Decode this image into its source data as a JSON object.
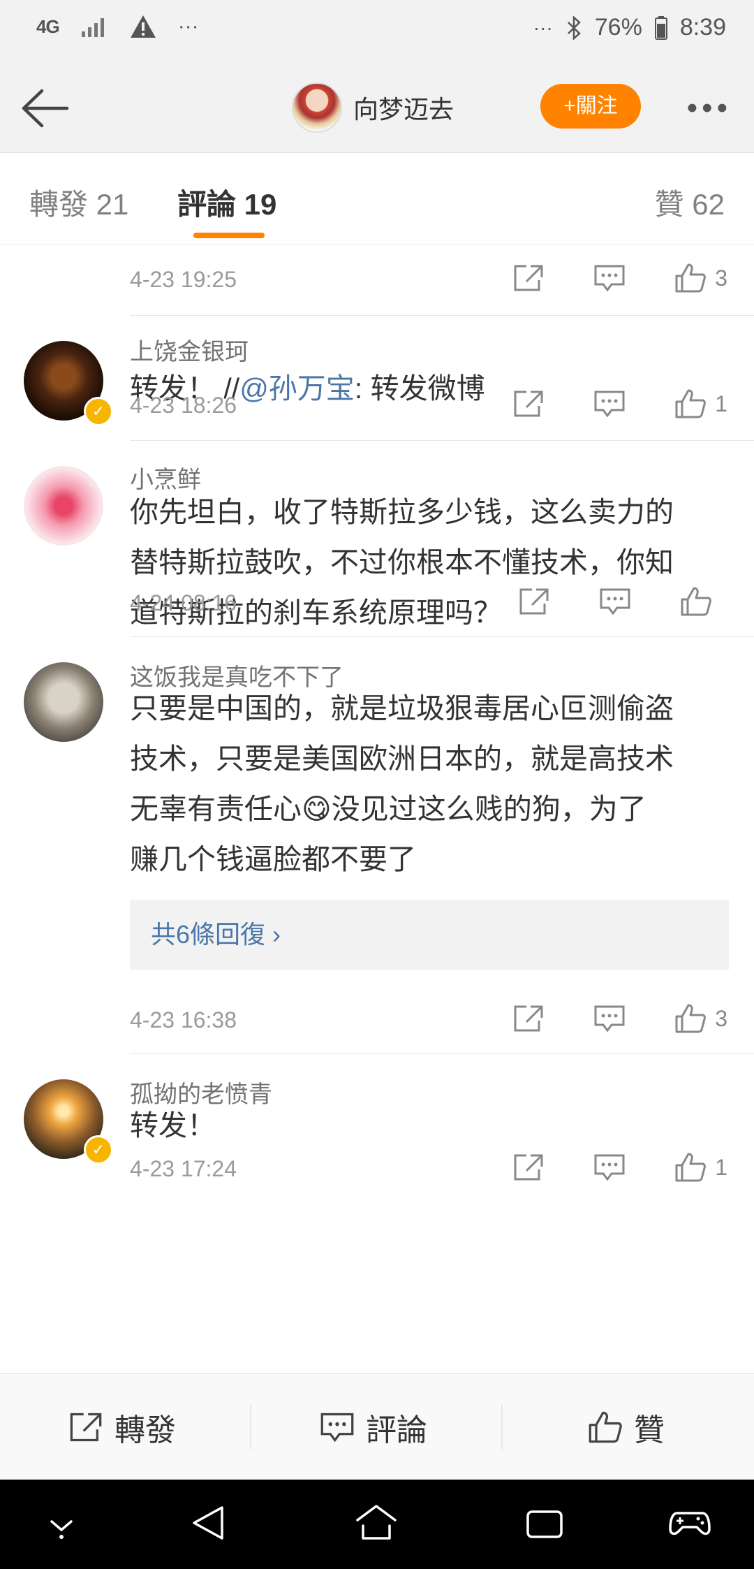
{
  "status_bar": {
    "network": "4G",
    "battery": "76%",
    "time": "8:39"
  },
  "header": {
    "title": "向梦迈去",
    "follow_label": "+關注"
  },
  "tabs": [
    {
      "label": "轉發 21"
    },
    {
      "label": "評論 19"
    },
    {
      "label": "贊 62"
    }
  ],
  "comments": [
    {
      "timestamp": "4-23 19:25",
      "likes": "3"
    },
    {
      "name": "上饶金银珂",
      "text_prefix": "转发！ //",
      "mention": "@孙万宝",
      "text_suffix": ": 转发微博",
      "timestamp": "4-23 18:26",
      "likes": "1"
    },
    {
      "name": "小烹鲜",
      "text_lines": [
        "你先坦白，收了特斯拉多少钱，这么卖力的",
        "替特斯拉鼓吹，不过你根本不懂技术，你知",
        "道特斯拉的刹车系统原理吗？"
      ],
      "timestamp": "4-24 08:16",
      "likes": ""
    },
    {
      "name": "这饭我是真吃不下了",
      "text_lines": [
        "只要是中国的，就是垃圾狠毒居心叵测偷盗",
        "技术，只要是美国欧洲日本的，就是高技术",
        "无辜有责任心😋没见过这么贱的狗，为了",
        "赚几个钱逼脸都不要了"
      ],
      "replies_label": "共6條回復 ›",
      "timestamp": "4-23 16:38",
      "likes": "3"
    },
    {
      "name": "孤拗的老愤青",
      "text": "转发！",
      "timestamp": "4-23 17:24",
      "likes": "1"
    }
  ],
  "bottom_bar": {
    "repost_label": "轉發",
    "comment_label": "評論",
    "like_label": "贊"
  },
  "colors": {
    "accent": "#ff8200",
    "link": "#4a77a8",
    "verified": "#f7b500"
  }
}
